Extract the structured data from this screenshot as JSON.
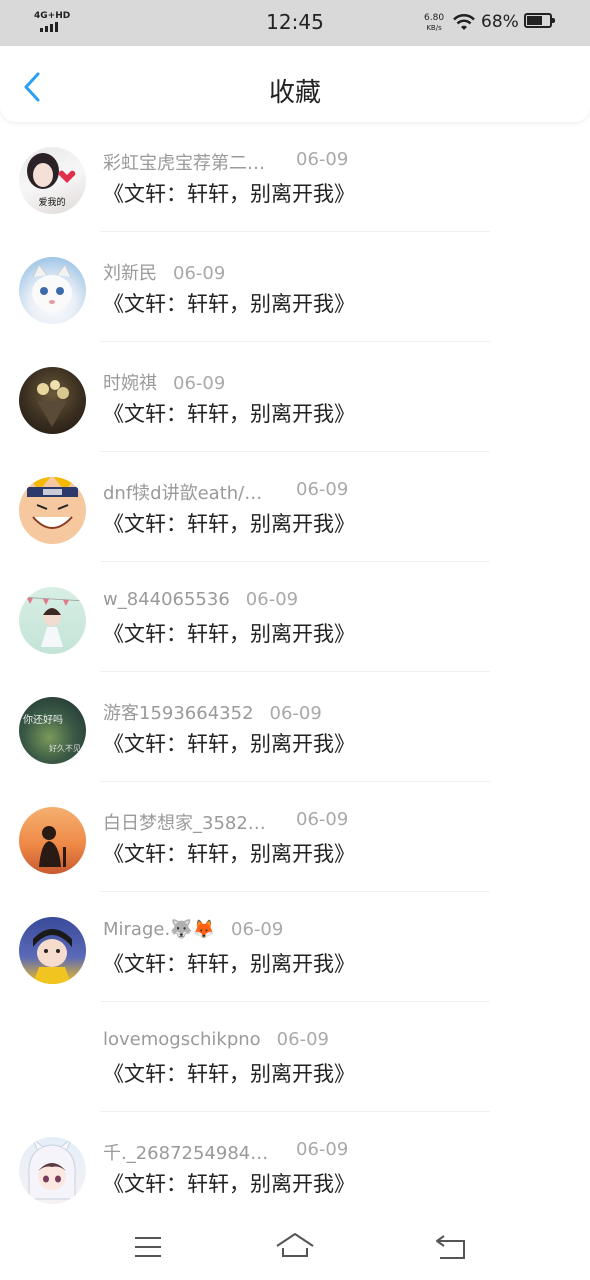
{
  "status_bar": {
    "network": "4G+HD",
    "time": "12:45",
    "speed_value": "6.80",
    "speed_unit": "KB/s",
    "battery": "68%"
  },
  "header": {
    "title": "收藏"
  },
  "items": [
    {
      "user": "彩虹宝虎宝荐第二…",
      "date": "06-09",
      "title": "《文轩：轩轩，别离开我》",
      "avatar_text": "爱我的"
    },
    {
      "user": "刘新民",
      "date": "06-09",
      "title": "《文轩：轩轩，别离开我》"
    },
    {
      "user": "时婉祺",
      "date": "06-09",
      "title": "《文轩：轩轩，别离开我》"
    },
    {
      "user": "dnf犊d讲歆eath/…",
      "date": "06-09",
      "title": "《文轩：轩轩，别离开我》"
    },
    {
      "user": "w_844065536",
      "date": "06-09",
      "title": "《文轩：轩轩，别离开我》"
    },
    {
      "user": "游客1593664352",
      "date": "06-09",
      "title": "《文轩：轩轩，别离开我》",
      "avatar_text": "你还好吗",
      "avatar_text2": "好久不见"
    },
    {
      "user": "白日梦想家_3582…",
      "date": "06-09",
      "title": "《文轩：轩轩，别离开我》"
    },
    {
      "user": "Mirage.🐺🦊",
      "date": "06-09",
      "title": "《文轩：轩轩，别离开我》"
    },
    {
      "user": "lovemogschikpno",
      "date": "06-09",
      "title": "《文轩：轩轩，别离开我》"
    },
    {
      "user": "千._2687254984…",
      "date": "06-09",
      "title": "《文轩：轩轩，别离开我》"
    }
  ],
  "icons": {
    "back": "chevron-left-icon",
    "menu": "menu-icon",
    "home": "home-icon",
    "return": "return-icon"
  },
  "colors": {
    "accent": "#2a9df4",
    "text": "#222222",
    "muted": "#9a9a9a"
  }
}
